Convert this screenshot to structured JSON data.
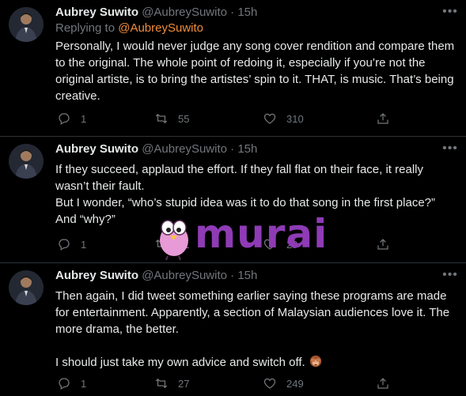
{
  "tweets": [
    {
      "name": "Aubrey Suwito",
      "handle": "@AubreySuwito",
      "separator": "·",
      "time": "15h",
      "replying_prefix": "Replying to",
      "replying_mention": "@AubreySuwito",
      "text": "Personally, I would never judge any song cover rendition and compare them to the original. The whole point of redoing it, especially if you’re not the original artiste, is to bring the artistes’ spin to it. THAT, is music. That’s being creative.",
      "replies": "1",
      "retweets": "55",
      "likes": "310"
    },
    {
      "name": "Aubrey Suwito",
      "handle": "@AubreySuwito",
      "separator": "·",
      "time": "15h",
      "text_1": "If they succeed, applaud the effort. If they fall flat on their face, it really wasn’t their fault.",
      "text_2": "But I wonder, “who’s stupid idea was it to do that song in the first place?” And “why?”",
      "replies": "1",
      "retweets": "31",
      "likes": "29"
    },
    {
      "name": "Aubrey Suwito",
      "handle": "@AubreySuwito",
      "separator": "·",
      "time": "15h",
      "text_1": "Then again, I did tweet something earlier saying these programs are made for entertainment. Apparently, a section of Malaysian audiences love it. The more drama, the better.",
      "text_2": "I should just take my own advice and switch off.",
      "emoji": "see-no-evil-monkey-icon",
      "replies": "1",
      "retweets": "27",
      "likes": "249"
    }
  ],
  "watermark": {
    "text": "murai"
  },
  "colors": {
    "background": "#000000",
    "text": "#e7e9ea",
    "muted": "#71767b",
    "mention": "#f18d3c",
    "divider": "#2f3336",
    "watermark": "#8e3bb5",
    "watermark_bird": "#e79ad6"
  }
}
